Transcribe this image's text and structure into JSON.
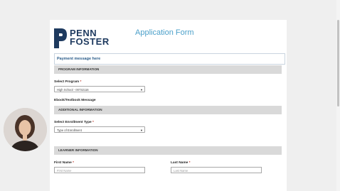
{
  "form": {
    "title": "Application Form",
    "logo": {
      "line1": "PENN",
      "line2": "FOSTER",
      "mark_color": "#1e3a5f"
    },
    "payment_message": "Payment message here",
    "sections": {
      "program": "PROGRAM INFORMATION",
      "additional": "ADDITIONAL INFORMATION",
      "learner": "LEARNER INFORMATION"
    },
    "program": {
      "label": "Select Program",
      "required_mark": "*",
      "selected_value": "High School - 00732116"
    },
    "ebook": {
      "label": "Ebook/Textbook Message"
    },
    "enrollment": {
      "label": "Select Enrollment Type",
      "required_mark": "*",
      "selected_value": "Type of Enrollment"
    },
    "learner": {
      "first_name_label": "First Name",
      "first_name_required": "*",
      "first_name_placeholder": "First Name",
      "last_name_label": "Last Name",
      "last_name_required": "*",
      "last_name_placeholder": "Last Name"
    }
  },
  "colors": {
    "accent": "#4a9fc9",
    "brand_navy": "#1e3a5f",
    "section_bar": "#d9d9d9",
    "page_bg": "#efefef"
  }
}
